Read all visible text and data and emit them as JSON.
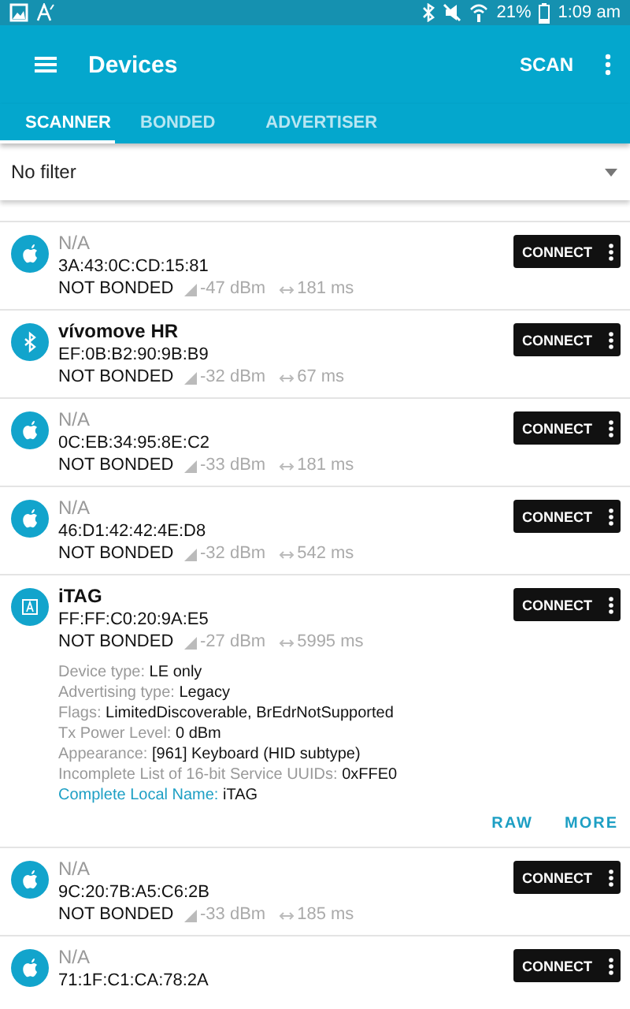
{
  "status_bar": {
    "battery": "21%",
    "time": "1:09 am"
  },
  "app_bar": {
    "title": "Devices",
    "action": "SCAN"
  },
  "tabs": [
    {
      "label": "SCANNER",
      "selected": true
    },
    {
      "label": "BONDED",
      "selected": false
    },
    {
      "label": "ADVERTISER",
      "selected": false
    }
  ],
  "filter": {
    "value": "No filter"
  },
  "devices": [
    {
      "kind": "apple",
      "name": "N/A",
      "named": false,
      "address": "3A:43:0C:CD:15:81",
      "bond": "NOT BONDED",
      "rssi": "-47 dBm",
      "interval": "181 ms",
      "button": "CONNECT"
    },
    {
      "kind": "bluetooth",
      "name": "vívomove HR",
      "named": true,
      "address": "EF:0B:B2:90:9B:B9",
      "bond": "NOT BONDED",
      "rssi": "-32 dBm",
      "interval": "67 ms",
      "button": "CONNECT"
    },
    {
      "kind": "apple",
      "name": "N/A",
      "named": false,
      "address": "0C:EB:34:95:8E:C2",
      "bond": "NOT BONDED",
      "rssi": "-33 dBm",
      "interval": "181 ms",
      "button": "CONNECT"
    },
    {
      "kind": "apple",
      "name": "N/A",
      "named": false,
      "address": "46:D1:42:42:4E:D8",
      "bond": "NOT BONDED",
      "rssi": "-32 dBm",
      "interval": "542 ms",
      "button": "CONNECT"
    },
    {
      "kind": "tag",
      "name": "iTAG",
      "named": true,
      "address": "FF:FF:C0:20:9A:E5",
      "bond": "NOT BONDED",
      "rssi": "-27 dBm",
      "interval": "5995 ms",
      "button": "CONNECT",
      "expanded": true,
      "details": [
        {
          "label": "Device type:",
          "value": "LE only",
          "highlighted": false
        },
        {
          "label": "Advertising type:",
          "value": "Legacy",
          "highlighted": false
        },
        {
          "label": "Flags:",
          "value": "LimitedDiscoverable, BrEdrNotSupported",
          "highlighted": false
        },
        {
          "label": "Tx Power Level:",
          "value": "0 dBm",
          "highlighted": false
        },
        {
          "label": "Appearance:",
          "value": "[961] Keyboard (HID subtype)",
          "highlighted": false
        },
        {
          "label": "Incomplete List of 16-bit Service UUIDs:",
          "value": "0xFFE0",
          "highlighted": false
        },
        {
          "label": "Complete Local Name:",
          "value": "iTAG",
          "highlighted": true
        }
      ],
      "actions": [
        "RAW",
        "MORE"
      ]
    },
    {
      "kind": "apple",
      "name": "N/A",
      "named": false,
      "address": "9C:20:7B:A5:C6:2B",
      "bond": "NOT BONDED",
      "rssi": "-33 dBm",
      "interval": "185 ms",
      "button": "CONNECT"
    },
    {
      "kind": "apple",
      "name": "N/A",
      "named": false,
      "address": "71:1F:C1:CA:78:2A",
      "button": "CONNECT"
    }
  ]
}
